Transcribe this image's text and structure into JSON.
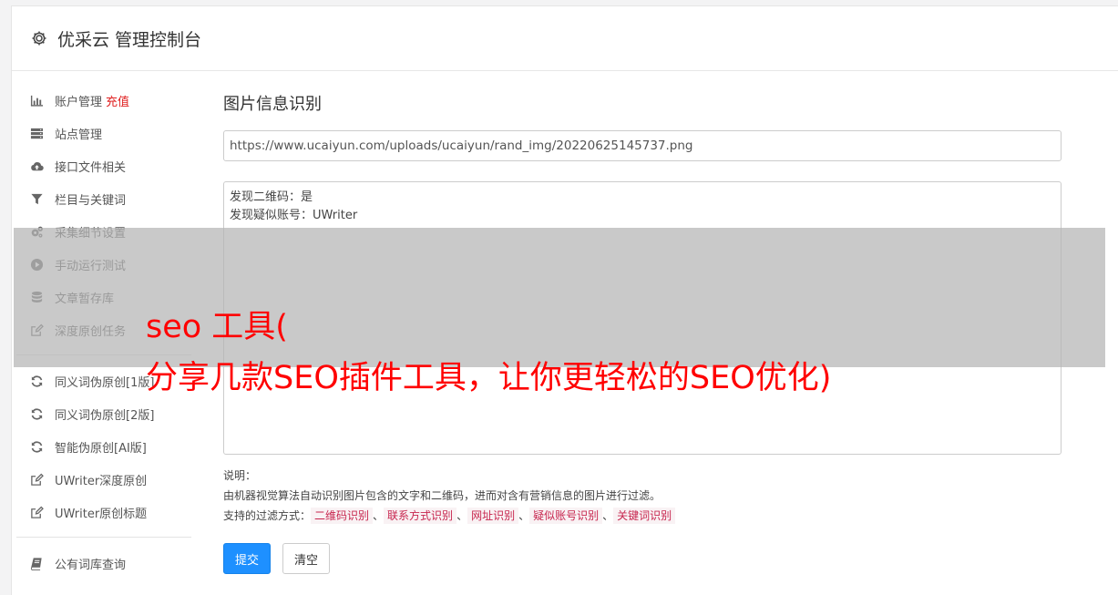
{
  "app": {
    "title": "优采云 管理控制台",
    "icon": "gear-icon"
  },
  "sidebar": {
    "group1": [
      {
        "label": "账户管理",
        "badge": "充值",
        "icon": "bar-chart-icon"
      },
      {
        "label": "站点管理",
        "icon": "server-icon"
      },
      {
        "label": "接口文件相关",
        "icon": "cloud-upload-icon"
      },
      {
        "label": "栏目与关键词",
        "icon": "filter-icon"
      },
      {
        "label": "采集细节设置",
        "icon": "cogs-icon"
      },
      {
        "label": "手动运行测试",
        "icon": "play-circle-icon"
      },
      {
        "label": "文章暂存库",
        "icon": "database-icon"
      },
      {
        "label": "深度原创任务",
        "icon": "edit-icon"
      }
    ],
    "group2": [
      {
        "label": "同义词伪原创[1版]",
        "icon": "refresh-icon"
      },
      {
        "label": "同义词伪原创[2版]",
        "icon": "refresh-icon"
      },
      {
        "label": "智能伪原创[AI版]",
        "icon": "refresh-icon"
      },
      {
        "label": "UWriter深度原创",
        "icon": "edit-icon"
      },
      {
        "label": "UWriter原创标题",
        "icon": "edit-icon"
      }
    ],
    "group3": [
      {
        "label": "公有词库查询",
        "icon": "book-icon"
      }
    ]
  },
  "main": {
    "heading": "图片信息识别",
    "url_value": "https://www.ucaiyun.com/uploads/ucaiyun/rand_img/20220625145737.png",
    "result_lines": [
      "发现二维码：是",
      "发现疑似账号：UWriter"
    ],
    "help_title": "说明：",
    "help_desc": "由机器视觉算法自动识别图片包含的文字和二维码，进而对含有营销信息的图片进行过滤。",
    "filter_prefix": "支持的过滤方式：",
    "filters": [
      "二维码识别",
      "联系方式识别",
      "网址识别",
      "疑似账号识别",
      "关键词识别"
    ],
    "filter_sep": "、",
    "submit_label": "提交",
    "clear_label": "清空"
  },
  "overlay": {
    "line1": "seo 工具(",
    "line2": "分享几款SEO插件工具，让你更轻松的SEO优化)"
  },
  "colors": {
    "primary": "#1e90ff",
    "badge": "#e02020",
    "chip_text": "#c7254e",
    "overlay_text": "#ff0000"
  }
}
